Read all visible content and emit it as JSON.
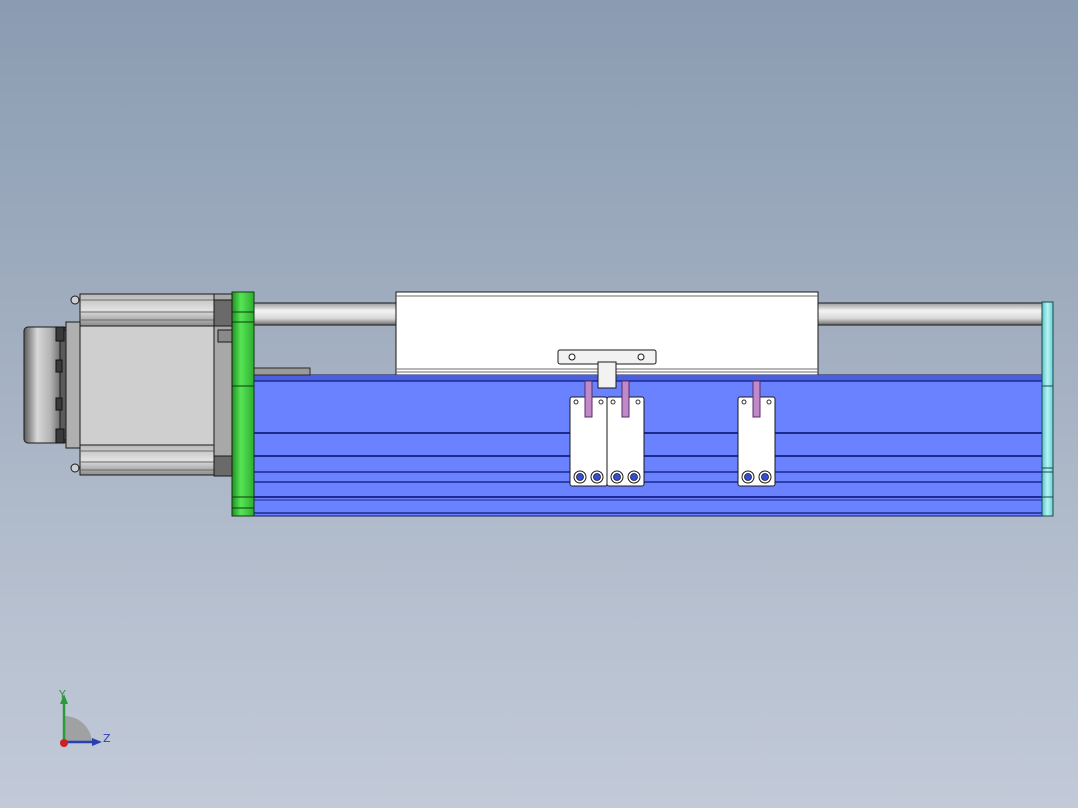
{
  "viewport": {
    "background_top": "#8a9cb2",
    "background_bottom": "#c2cad8"
  },
  "model": {
    "parts": [
      "servo-motor",
      "motor-flange",
      "guide-rod",
      "carriage-cover",
      "t-bracket",
      "linear-body",
      "sensor-blocks",
      "end-cap"
    ],
    "colors": {
      "body_blue": "#6a82ff",
      "body_stripe": "#1b2a8c",
      "flange_green": "#3fd83f",
      "end_cap_cyan": "#8fe8ea",
      "motor_gray": "#c8c8c8",
      "bracket_purple": "#c08ac8"
    }
  },
  "triad": {
    "y_label": "Y",
    "z_label": "Z",
    "y_color": "#2a9a3a",
    "z_color": "#2b3fb0",
    "x_color": "#d02020"
  }
}
